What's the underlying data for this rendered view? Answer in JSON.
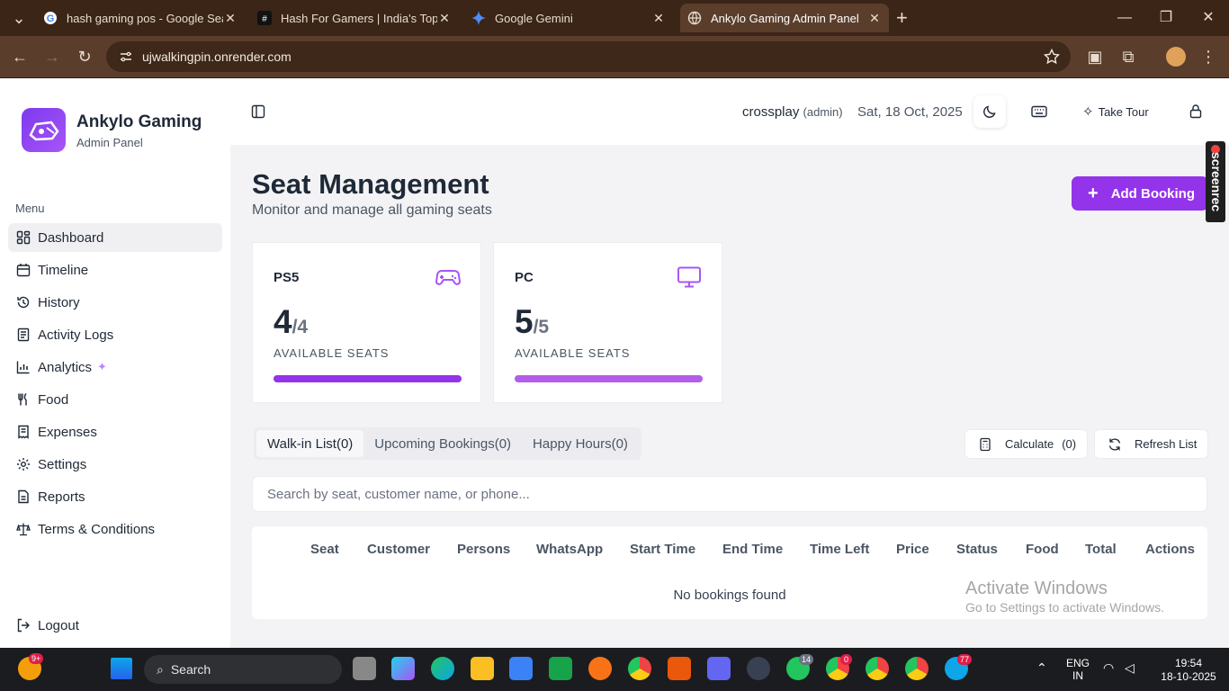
{
  "browser": {
    "tabs": [
      {
        "label": "hash gaming pos - Google Sear",
        "icon": "google-icon"
      },
      {
        "label": "Hash For Gamers | India's Top G",
        "icon": "hash-icon"
      },
      {
        "label": "Google Gemini",
        "icon": "gemini-icon"
      },
      {
        "label": "Ankylo Gaming Admin Panel",
        "icon": "globe-icon",
        "active": true
      }
    ],
    "url": "ujwalkingpin.onrender.com"
  },
  "sidebar": {
    "brand": "Ankylo Gaming",
    "subtitle": "Admin Panel",
    "menu_label": "Menu",
    "items": [
      {
        "label": "Dashboard",
        "icon": "grid-icon",
        "active": true
      },
      {
        "label": "Timeline",
        "icon": "calendar-icon"
      },
      {
        "label": "History",
        "icon": "history-icon"
      },
      {
        "label": "Activity Logs",
        "icon": "list-icon"
      },
      {
        "label": "Analytics",
        "icon": "chart-icon"
      },
      {
        "label": "Food",
        "icon": "utensils-icon"
      },
      {
        "label": "Expenses",
        "icon": "receipt-icon"
      },
      {
        "label": "Settings",
        "icon": "gear-icon"
      },
      {
        "label": "Reports",
        "icon": "document-icon"
      },
      {
        "label": "Terms & Conditions",
        "icon": "scale-icon"
      }
    ],
    "logout": "Logout"
  },
  "header": {
    "user": "crossplay",
    "role": "(admin)",
    "date": "Sat, 18 Oct, 2025",
    "take_tour": "Take Tour"
  },
  "page": {
    "title": "Seat Management",
    "subtitle": "Monitor and manage all gaming seats",
    "add_booking": "Add Booking"
  },
  "seats": [
    {
      "name": "PS5",
      "available": "4",
      "total": "/4",
      "label": "AVAILABLE SEATS",
      "icon": "gamepad-icon",
      "fill": 1.0,
      "color": "#9333ea"
    },
    {
      "name": "PC",
      "available": "5",
      "total": "/5",
      "label": "AVAILABLE SEATS",
      "icon": "monitor-icon",
      "fill": 1.0,
      "color": "#b45ee8"
    }
  ],
  "list_tabs": [
    "Walk-in List(0)",
    "Upcoming Bookings(0)",
    "Happy Hours(0)"
  ],
  "calculate": {
    "label": "Calculate",
    "count": "(0)"
  },
  "refresh": "Refresh List",
  "search_placeholder": "Search by seat, customer name, or phone...",
  "table": {
    "headers": [
      "Seat",
      "Customer",
      "Persons",
      "WhatsApp",
      "Start Time",
      "End Time",
      "Time Left",
      "Price",
      "Status",
      "Food",
      "Total",
      "Actions"
    ],
    "empty": "No bookings found"
  },
  "watermark": {
    "line1": "Activate Windows",
    "line2": "Go to Settings to activate Windows."
  },
  "screenrec": "screenrec",
  "taskbar": {
    "search": "Search",
    "lang": "ENG",
    "region": "IN",
    "time": "19:54",
    "date": "18-10-2025",
    "badges": {
      "weather": "9+",
      "whatsapp": "14",
      "chrome2": "0",
      "telegram": "77"
    }
  }
}
